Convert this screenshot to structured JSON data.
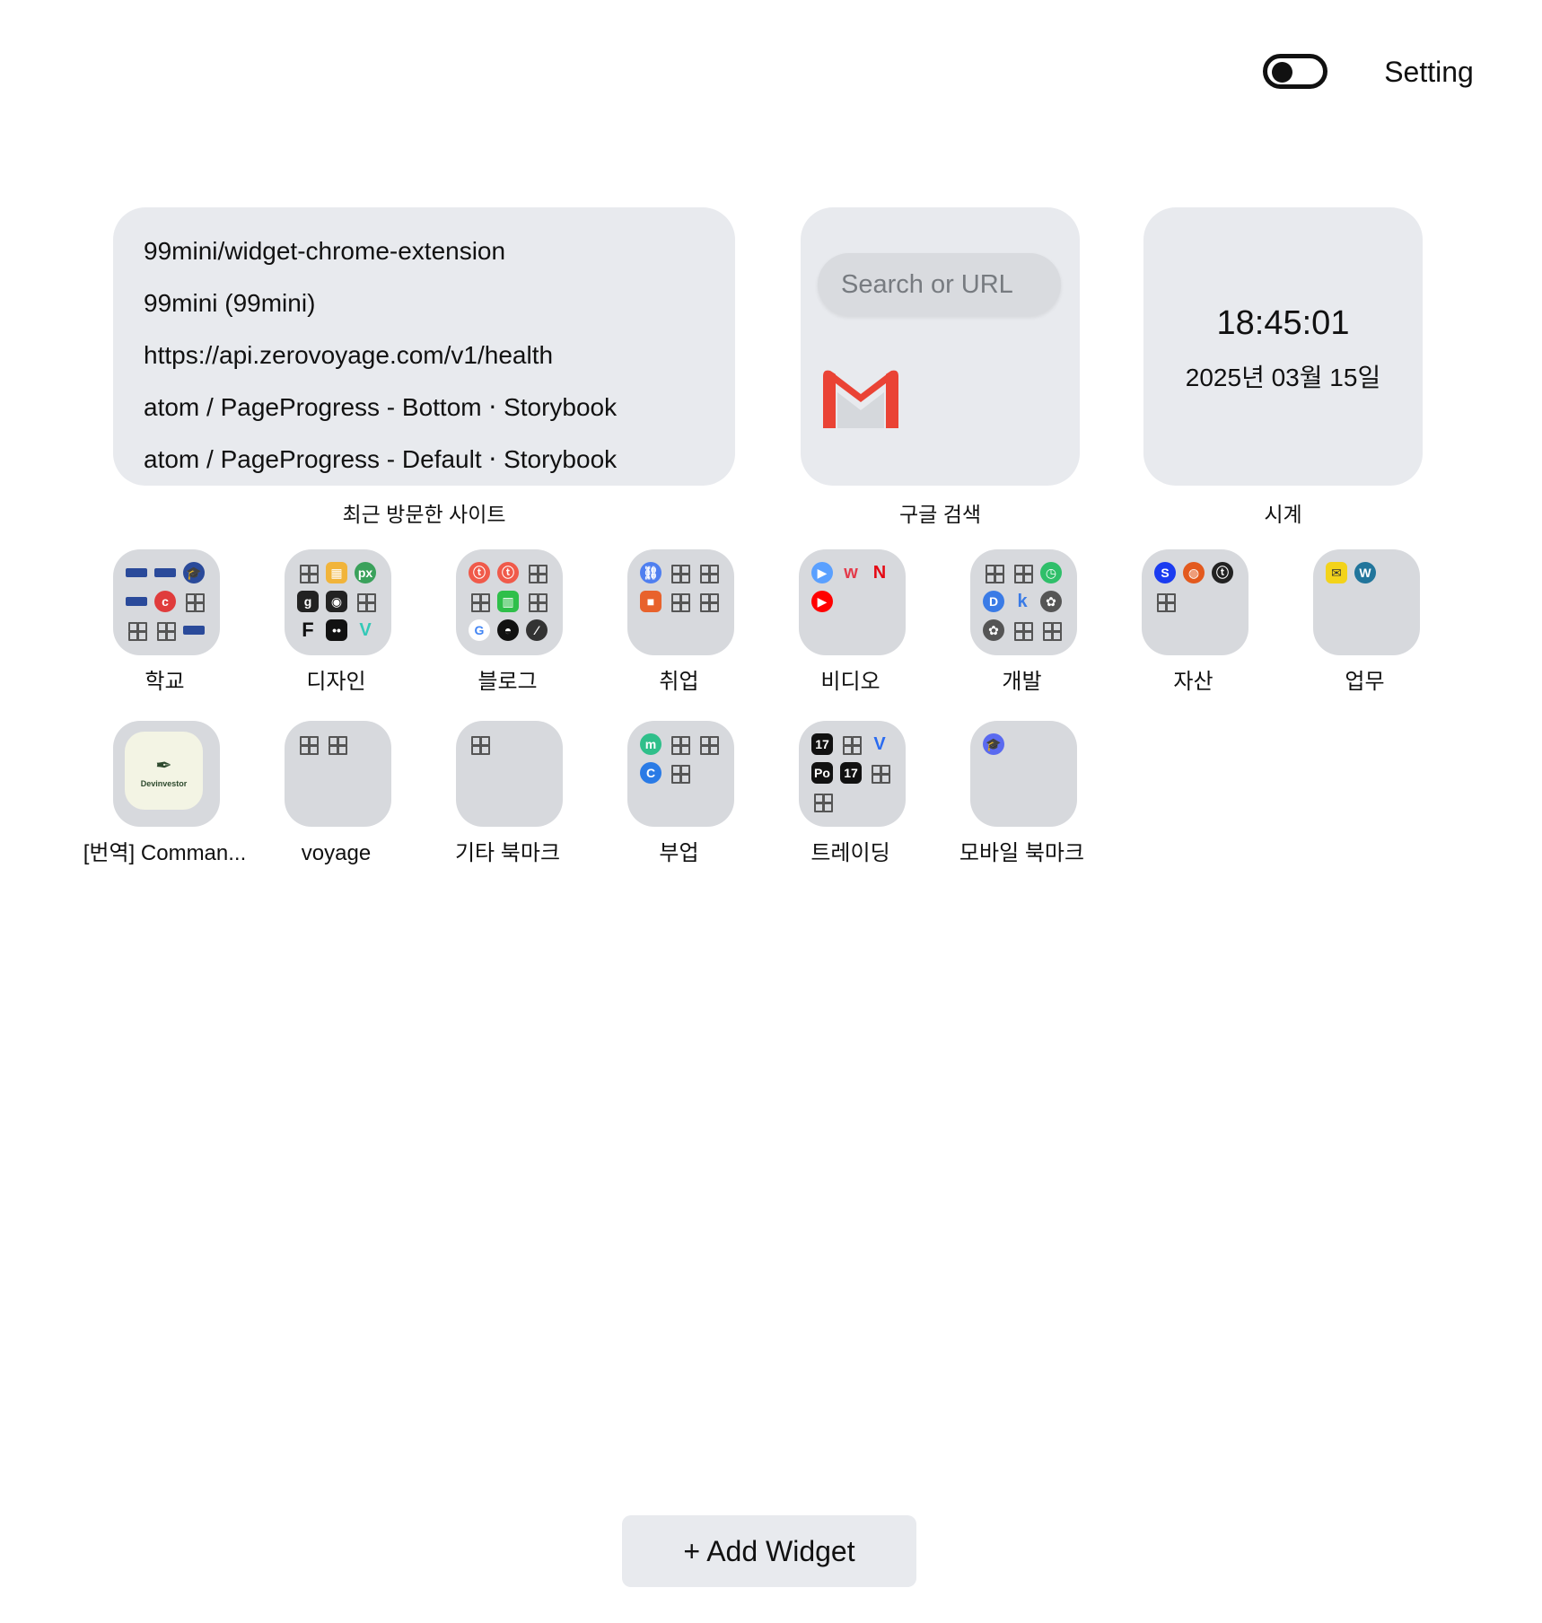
{
  "header": {
    "theme_toggle": {
      "state": "off"
    },
    "setting_label": "Setting"
  },
  "widgets": {
    "recent_sites": {
      "label": "최근 방문한 사이트",
      "items": [
        "99mini/widget-chrome-extension",
        "99mini (99mini)",
        "https://api.zerovoyage.com/v1/health",
        "atom / PageProgress - Bottom ⋅ Storybook",
        "atom / PageProgress - Default ⋅ Storybook"
      ]
    },
    "google_search": {
      "label": "구글 검색",
      "placeholder": "Search or URL",
      "shortcut_icon": "gmail-icon"
    },
    "clock": {
      "label": "시계",
      "time": "18:45:01",
      "date": "2025년 03월 15일"
    }
  },
  "folders": [
    {
      "label": "학교",
      "icons": [
        "bar:#2a4a9a",
        "bar:#2a4a9a",
        "hat:#2a4a9a",
        "bar:#2a4a9a",
        "cafe:#e03c3c",
        "grid",
        "grid",
        "grid",
        "bar:#2a4a9a"
      ]
    },
    {
      "label": "디자인",
      "icons": [
        "grid",
        "img:#f1b43a",
        "px:#3aa15b",
        "g:#222",
        "cam:#222",
        "grid",
        "f:#111",
        "dots:#111",
        "v:#33c9b7"
      ]
    },
    {
      "label": "블로그",
      "icons": [
        "t:#f05a4a",
        "t:#f05a4a",
        "grid",
        "grid",
        "chart:#2fbf4a",
        "grid",
        "g-color:#ffffff",
        "gh:#111",
        "slash:#333"
      ]
    },
    {
      "label": "취업",
      "icons": [
        "link:#4f7ff0",
        "grid",
        "grid",
        "sq:#e8622c",
        "grid",
        "grid"
      ]
    },
    {
      "label": "비디오",
      "icons": [
        "play:#5aa0ff",
        "w:#e43a4a",
        "n:#e50914",
        "yt:#ff0000"
      ]
    },
    {
      "label": "개발",
      "icons": [
        "grid",
        "grid",
        "clock:#2fbf6a",
        "d:#3a7be6",
        "k:#3a7be6",
        "ai:#555",
        "ai:#555",
        "grid",
        "grid"
      ]
    },
    {
      "label": "자산",
      "icons": [
        "s:#1b3cf0",
        "o:#e35a1e",
        "t:#222",
        "grid"
      ]
    },
    {
      "label": "업무",
      "icons": [
        "mail:#f3d31a",
        "wp:#21759b"
      ]
    },
    {
      "label": "[번역] Comman...",
      "thumb": {
        "glyph": "✒",
        "text": "Devinvestor"
      }
    },
    {
      "label": "voyage",
      "icons": [
        "grid",
        "grid"
      ]
    },
    {
      "label": "기타 북마크",
      "icons": [
        "grid"
      ]
    },
    {
      "label": "부업",
      "icons": [
        "m:#2fbf8a",
        "grid",
        "grid",
        "c:#2a7be6",
        "grid"
      ]
    },
    {
      "label": "트레이딩",
      "icons": [
        "tv:#111",
        "grid",
        "v:#2a6bf0",
        "po:#111",
        "tv:#111",
        "grid",
        "grid"
      ]
    },
    {
      "label": "모바일 북마크",
      "icons": [
        "hat:#5a6af0"
      ]
    }
  ],
  "footer": {
    "add_widget_label": "+ Add Widget"
  }
}
